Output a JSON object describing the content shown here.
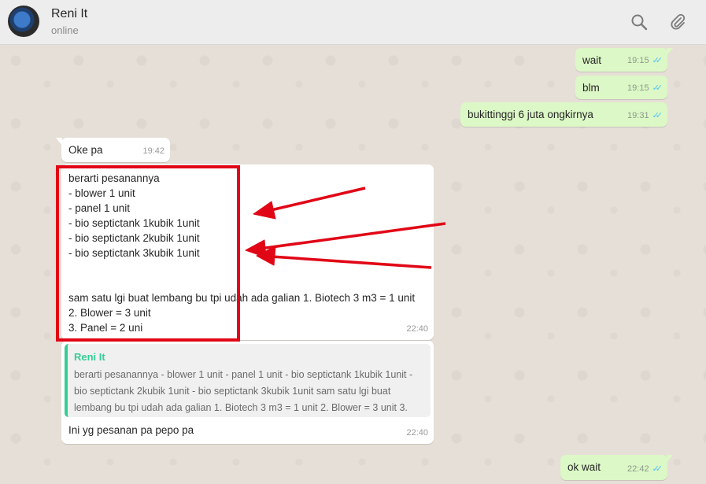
{
  "header": {
    "contact_name": "Reni It",
    "status": "online",
    "search_icon": "search-icon",
    "attach_icon": "paperclip-icon"
  },
  "colors": {
    "outgoing_bubble": "#dcf8c6",
    "incoming_bubble": "#ffffff",
    "read_ticks": "#4fc3f7",
    "highlight_red": "#e10616",
    "quote_accent": "#35cd96"
  },
  "messages": [
    {
      "direction": "out",
      "text": "wait",
      "time": "19:15",
      "read": true
    },
    {
      "direction": "out",
      "text": "blm",
      "time": "19:15",
      "read": true
    },
    {
      "direction": "out",
      "text": "bukittinggi 6 juta ongkirnya",
      "time": "19:31",
      "read": true
    },
    {
      "direction": "in",
      "text": "Oke pa",
      "time": "19:42"
    },
    {
      "direction": "in",
      "text": "berarti pesanannya\n- blower 1 unit\n- panel 1 unit\n- bio septictank 1kubik 1unit\n- bio septictank 2kubik 1unit\n- bio septictank 3kubik 1unit\n\n\nsam satu lgi buat lembang bu tpi udah ada galian 1. Biotech 3 m3 = 1 unit\n2. Blower = 3 unit\n3. Panel = 2 uni",
      "time": "22:40"
    },
    {
      "direction": "in",
      "quote_author": "Reni It",
      "quote_text": "berarti pesanannya - blower 1 unit - panel 1 unit - bio septictank 1kubik 1unit -\nbio septictank 2kubik 1unit - bio septictank 3kubik 1unit sam satu lgi buat\nlembang bu tpi udah ada galian 1. Biotech 3 m3 = 1 unit 2. Blower = 3 unit 3.",
      "text": "Ini yg pesanan pa pepo pa",
      "time": "22:40"
    },
    {
      "direction": "out",
      "text": "ok wait",
      "time": "22:42",
      "read": true
    }
  ]
}
